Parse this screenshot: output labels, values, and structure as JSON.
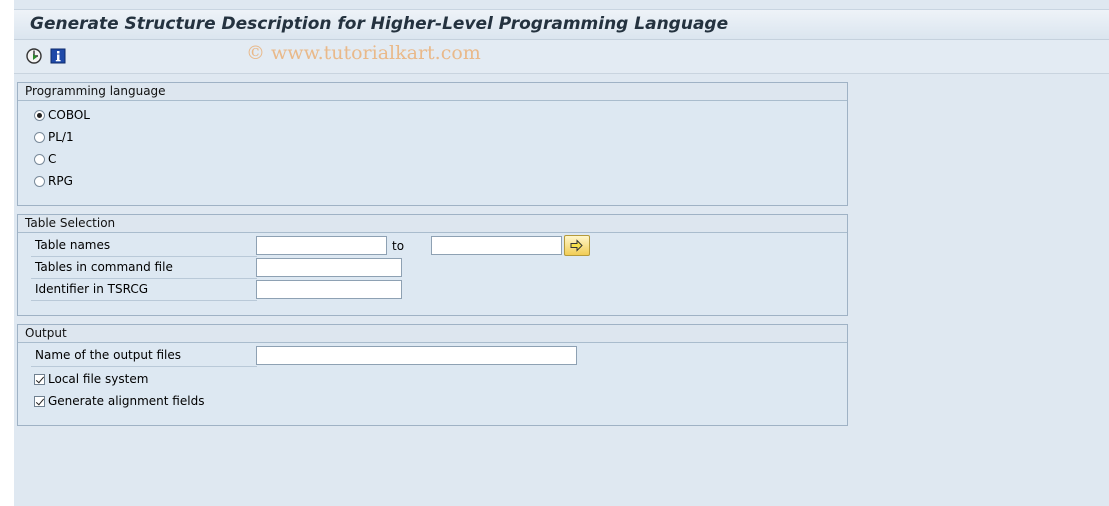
{
  "window": {
    "title": "Generate Structure Description for Higher-Level Programming Language",
    "watermark": "© www.tutorialkart.com"
  },
  "toolbar": {
    "execute_icon": "execute-icon",
    "info_icon": "info-icon"
  },
  "programming_language": {
    "header": "Programming language",
    "options": [
      {
        "label": "COBOL",
        "selected": true
      },
      {
        "label": "PL/1",
        "selected": false
      },
      {
        "label": "C",
        "selected": false
      },
      {
        "label": "RPG",
        "selected": false
      }
    ]
  },
  "table_selection": {
    "header": "Table Selection",
    "table_names_label": "Table names",
    "to_label": "to",
    "table_names_from": "",
    "table_names_to": "",
    "tables_in_command_file_label": "Tables in command file",
    "tables_in_command_file": "",
    "identifier_label": "Identifier in TSRCG",
    "identifier": ""
  },
  "output": {
    "header": "Output",
    "output_files_label": "Name of the output files",
    "output_files": "",
    "local_file_system_label": "Local file system",
    "local_file_system": true,
    "generate_alignment_label": "Generate alignment fields",
    "generate_alignment": true
  },
  "colors": {
    "background": "#dfe8f1",
    "title_text": "#24323f",
    "watermark": "#e9b98a",
    "frame_border": "#9fb2c5"
  }
}
